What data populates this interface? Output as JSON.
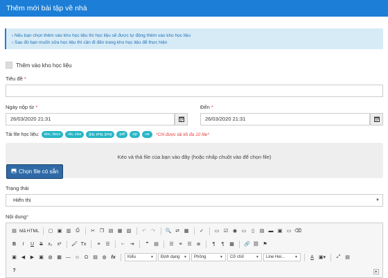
{
  "dialog": {
    "title": "Thêm mới bài tập về nhà"
  },
  "info": {
    "line1": "Nếu bạn chọn thêm vào kho học liệu thì học liệu sẽ được tự động thêm vào kho học liệu",
    "line2": "Sau đó bạn muốn sửa học liệu thì cần đi đến trang kho học liệu để thực hiện"
  },
  "add_to_library": {
    "label": "Thêm vào kho học liệu",
    "checked": false
  },
  "title_field": {
    "label": "Tiêu đề",
    "required_mark": "*",
    "value": ""
  },
  "submit_from": {
    "label": "Ngày nộp từ",
    "required_mark": "*",
    "value": "26/03/2020 21:31"
  },
  "submit_to": {
    "label": "Đến",
    "required_mark": "*",
    "value": "26/03/2020 21:31"
  },
  "upload": {
    "label": "Tải file học liệu:",
    "types": [
      "doc, docx",
      "xls, xlsx",
      "jpg, png, jpeg",
      "pdf",
      "zip",
      "rar"
    ],
    "note": "*Chỉ được tải tối đa 10 file*",
    "drop_text": "Kéo và thả file của bạn vào đây (hoặc nhấp chuột vào để chọn file)",
    "choose_button": "Chọn file có sẵn"
  },
  "status": {
    "label": "Trạng thái",
    "value": "Hiển thị"
  },
  "content": {
    "label": "Nội dung",
    "required_mark": "*",
    "toolbar": {
      "source_label": "Mã HTML",
      "style_combo": "Kiểu",
      "format_combo": "Định dạng",
      "font_combo": "Phông",
      "size_combo": "Cỡ chữ",
      "lineheight_combo": "Line Hei...",
      "help": "?"
    }
  },
  "colors": {
    "header": "#1c7ed6",
    "pill": "#29b6c7",
    "button": "#2f6aa6",
    "required": "#e53935"
  }
}
